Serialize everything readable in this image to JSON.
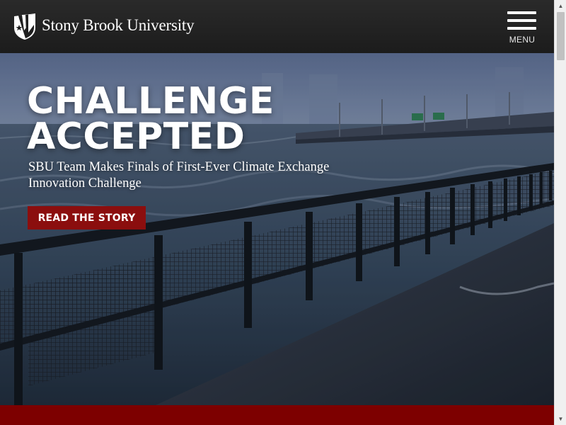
{
  "header": {
    "brand": "Stony Brook University",
    "menu_label": "MENU"
  },
  "hero": {
    "headline_line1": "CHALLENGE",
    "headline_line2": "ACCEPTED",
    "subhead": "SBU Team Makes Finals of First-Ever Climate Exchange Innovation Challenge",
    "cta_label": "READ THE STORY"
  },
  "colors": {
    "header_bg": "#1c1c1c",
    "brand_red": "#8b0e0e",
    "band_red": "#7d0000"
  },
  "icons": [
    "university-shield-logo",
    "hamburger-menu-icon",
    "scroll-up-arrow",
    "scroll-down-arrow"
  ]
}
